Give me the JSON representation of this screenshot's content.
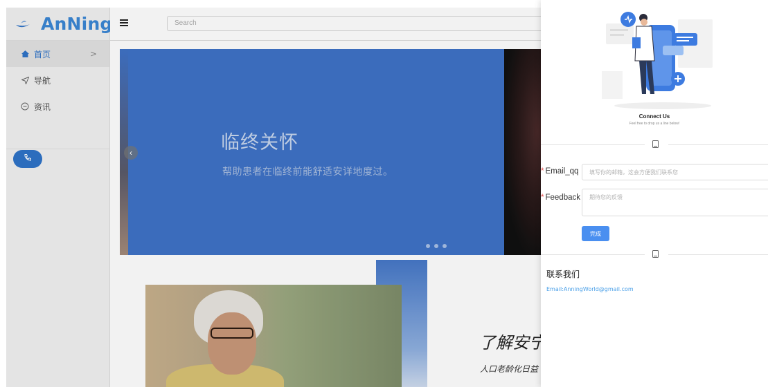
{
  "app": {
    "logo_text": "AnNing"
  },
  "sidebar": {
    "items": [
      {
        "label": "首页",
        "icon": "home-icon",
        "active": true,
        "chevron": ">"
      },
      {
        "label": "导航",
        "icon": "navigation-icon",
        "active": false
      },
      {
        "label": "资讯",
        "icon": "chat-icon",
        "active": false
      }
    ],
    "pill_icon": "phone-icon"
  },
  "topbar": {
    "search_placeholder": "Search"
  },
  "carousel": {
    "title": "临终关怀",
    "subtitle": "帮助患者在临终前能舒适安详地度过。",
    "prev_label": "‹",
    "slide_count": 3
  },
  "about": {
    "title": "了解安宁",
    "subtitle": "人口老龄化日益"
  },
  "drawer": {
    "title": "Connect Us",
    "subtitle": "Feel free to drop us a line below!",
    "form": {
      "email_label": "Email_qq",
      "email_placeholder": "填写你的邮箱，这会方便我们联系您",
      "feedback_label": "Feedback",
      "feedback_placeholder": "期待您的反馈",
      "submit_label": "完成"
    },
    "contact_heading": "联系我们",
    "contact_email": "Email:AnningWorld@gmail.com"
  },
  "colors": {
    "accent": "#2f73c8",
    "carousel_bg": "#3f72c7",
    "submit": "#4a8ff0",
    "required": "#e34b4b",
    "link": "#4ba0e8"
  }
}
